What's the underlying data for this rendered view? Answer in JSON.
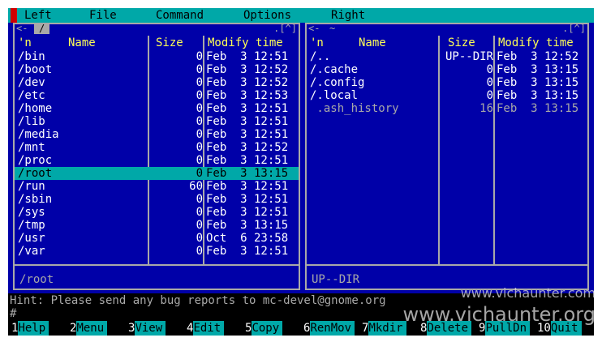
{
  "menu": [
    "Left",
    "File",
    "Command",
    "Options",
    "Right"
  ],
  "left_panel": {
    "path": "/",
    "header_right": ".[^]",
    "columns": {
      "n": "'n",
      "name": "Name",
      "size": "Size",
      "modify": "Modify time"
    },
    "rows": [
      {
        "name": "/bin",
        "size": "0",
        "modify": "Feb  3 12:51"
      },
      {
        "name": "/boot",
        "size": "0",
        "modify": "Feb  3 12:52"
      },
      {
        "name": "/dev",
        "size": "0",
        "modify": "Feb  3 12:52"
      },
      {
        "name": "/etc",
        "size": "0",
        "modify": "Feb  3 12:53"
      },
      {
        "name": "/home",
        "size": "0",
        "modify": "Feb  3 12:51"
      },
      {
        "name": "/lib",
        "size": "0",
        "modify": "Feb  3 12:51"
      },
      {
        "name": "/media",
        "size": "0",
        "modify": "Feb  3 12:51"
      },
      {
        "name": "/mnt",
        "size": "0",
        "modify": "Feb  3 12:52"
      },
      {
        "name": "/proc",
        "size": "0",
        "modify": "Feb  3 12:51"
      },
      {
        "name": "/root",
        "size": "0",
        "modify": "Feb  3 13:15"
      },
      {
        "name": "/run",
        "size": "60",
        "modify": "Feb  3 12:51"
      },
      {
        "name": "/sbin",
        "size": "0",
        "modify": "Feb  3 12:51"
      },
      {
        "name": "/sys",
        "size": "0",
        "modify": "Feb  3 12:51"
      },
      {
        "name": "/tmp",
        "size": "0",
        "modify": "Feb  3 13:15"
      },
      {
        "name": "/usr",
        "size": "0",
        "modify": "Oct  6 23:58"
      },
      {
        "name": "/var",
        "size": "0",
        "modify": "Feb  3 12:51"
      }
    ],
    "selected_index": 9,
    "status": "/root"
  },
  "right_panel": {
    "path": "~",
    "header_right": ".[^]",
    "columns": {
      "n": "'n",
      "name": "Name",
      "size": "Size",
      "modify": "Modify time"
    },
    "rows": [
      {
        "name": "/..",
        "size": "UP--DIR",
        "modify": "Feb  3 12:52"
      },
      {
        "name": "/.cache",
        "size": "0",
        "modify": "Feb  3 13:15"
      },
      {
        "name": "/.config",
        "size": "0",
        "modify": "Feb  3 13:15"
      },
      {
        "name": "/.local",
        "size": "0",
        "modify": "Feb  3 13:15"
      },
      {
        "name": " .ash_history",
        "size": "16",
        "modify": "Feb  3 13:15"
      }
    ],
    "dim_index": 4,
    "status": "UP--DIR"
  },
  "hint": "Hint: Please send any bug reports to mc-devel@gnome.org",
  "prompt": "#",
  "fkeys": [
    {
      "n": "1",
      "label": "Help"
    },
    {
      "n": "2",
      "label": "Menu"
    },
    {
      "n": "3",
      "label": "View"
    },
    {
      "n": "4",
      "label": "Edit"
    },
    {
      "n": "5",
      "label": "Copy"
    },
    {
      "n": "6",
      "label": "RenMov"
    },
    {
      "n": "7",
      "label": "Mkdir"
    },
    {
      "n": "8",
      "label": "Delete"
    },
    {
      "n": "9",
      "label": "PullDn"
    },
    {
      "n": "10",
      "label": "Quit"
    }
  ],
  "watermark": {
    "line1": "www.vichaunter.com",
    "line2": "www.vichaunter.org"
  },
  "colors": {
    "background": "#0000a8",
    "menubar": "#00a8a8",
    "header": "#ffff55",
    "selection": "#00a8a8"
  }
}
